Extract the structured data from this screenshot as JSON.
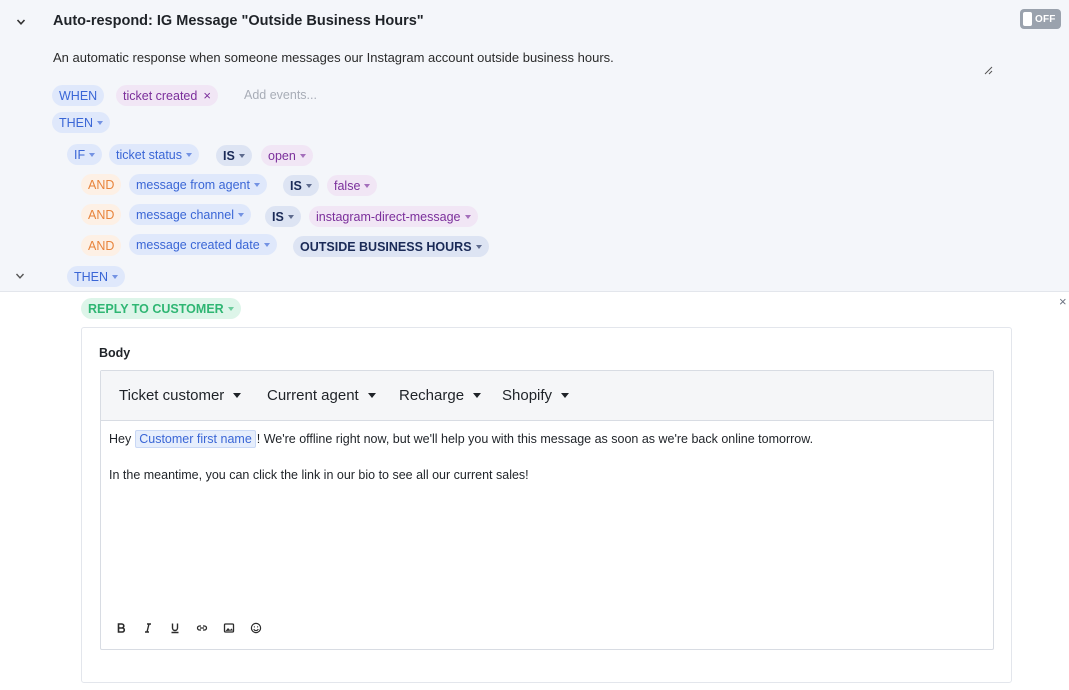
{
  "rule": {
    "title": "Auto-respond: IG Message \"Outside Business Hours\"",
    "toggle_label": "OFF",
    "description": "An automatic response when someone messages our Instagram account outside business hours."
  },
  "trigger": {
    "when_label": "WHEN",
    "event": "ticket created",
    "add_events_placeholder": "Add events..."
  },
  "then_label": "THEN",
  "conditions": {
    "if_label": "IF",
    "rows": [
      {
        "connector": "",
        "field": "ticket status",
        "operator": "IS",
        "value": "open"
      },
      {
        "connector": "AND",
        "field": "message from agent",
        "operator": "IS",
        "value": "false"
      },
      {
        "connector": "AND",
        "field": "message channel",
        "operator": "IS",
        "value": "instagram-direct-message"
      },
      {
        "connector": "AND",
        "field": "message created date",
        "operator": "",
        "value": "OUTSIDE BUSINESS HOURS"
      }
    ]
  },
  "inner_then_label": "THEN",
  "action": {
    "label": "REPLY TO CUSTOMER",
    "body_label": "Body",
    "toolbar": [
      "Ticket customer",
      "Current agent",
      "Recharge",
      "Shopify"
    ],
    "message": {
      "line1_prefix": "Hey",
      "variable": "Customer first name",
      "line1_suffix": "! We're offline right now, but we'll help you with this message as soon as we're back online tomorrow.",
      "line2": "In the meantime, you can click the link in our bio to see all our current sales!"
    },
    "format_buttons": [
      "bold-icon",
      "italic-icon",
      "underline-icon",
      "link-icon",
      "image-icon",
      "emoji-icon"
    ]
  },
  "colors": {
    "accent_blue": "#3a66d6",
    "purple": "#7b2f9b",
    "orange": "#e8843c",
    "green": "#2fb673",
    "navy": "#1a2a57"
  }
}
